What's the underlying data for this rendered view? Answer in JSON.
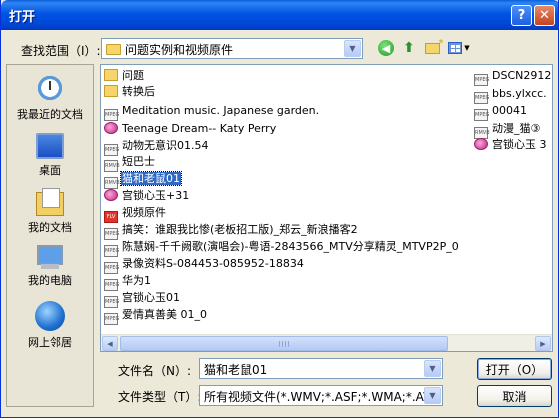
{
  "window": {
    "title": "打开"
  },
  "titlebar": {
    "help_label": "?",
    "close_label": "✕"
  },
  "lookin": {
    "label": "查找范围（I）:",
    "value": "问题实例和视频原件"
  },
  "places": [
    {
      "label": "我最近的文档",
      "icon": "recent-documents-icon"
    },
    {
      "label": "桌面",
      "icon": "desktop-icon"
    },
    {
      "label": "我的文档",
      "icon": "my-documents-icon"
    },
    {
      "label": "我的电脑",
      "icon": "my-computer-icon"
    },
    {
      "label": "网上邻居",
      "icon": "network-places-icon"
    }
  ],
  "files_col1": [
    {
      "name": "问题",
      "type": "folder"
    },
    {
      "name": "转换后",
      "type": "folder"
    },
    {
      "name": "Meditation music.  Japanese garden.",
      "type": "mpeg"
    },
    {
      "name": "Teenage Dream-- Katy Perry",
      "type": "media"
    },
    {
      "name": "动物无意识01.54",
      "type": "mpeg"
    },
    {
      "name": "短巴士",
      "type": "rmvb"
    },
    {
      "name": "猫和老鼠01",
      "type": "rmvb",
      "selected": true
    },
    {
      "name": "宫锁心玉+31",
      "type": "media"
    },
    {
      "name": "视频原件",
      "type": "flv"
    },
    {
      "name": "搞笑：谁跟我比惨(老板招工版)_郑云_新浪播客2",
      "type": "mpeg"
    },
    {
      "name": "陈慧娴-千千阙歌(演唱会)-粤语-2843566_MTV分享精灵_MTVP2P_0",
      "type": "mpeg"
    },
    {
      "name": "录像资料S-084453-085952-18834",
      "type": "mpeg"
    },
    {
      "name": "华为1",
      "type": "mpeg"
    },
    {
      "name": "宫锁心玉01",
      "type": "mpeg"
    },
    {
      "name": "爱情真善美 01_0",
      "type": "mpeg"
    }
  ],
  "files_col2": [
    {
      "name": "DSCN2912",
      "type": "mpeg"
    },
    {
      "name": "bbs.ylxcc.",
      "type": "mpeg"
    },
    {
      "name": "00041",
      "type": "mpeg"
    },
    {
      "name": "动漫_猫③",
      "type": "rmvb"
    },
    {
      "name": "宫锁心玉 3",
      "type": "media"
    }
  ],
  "filename": {
    "label": "文件名（N）:",
    "value": "猫和老鼠01"
  },
  "filetype": {
    "label": "文件类型（T）:",
    "value": "所有视频文件(*.WMV;*.ASF;*.WMA;*.AVI;"
  },
  "buttons": {
    "open": "打开（O）",
    "cancel": "取消"
  }
}
